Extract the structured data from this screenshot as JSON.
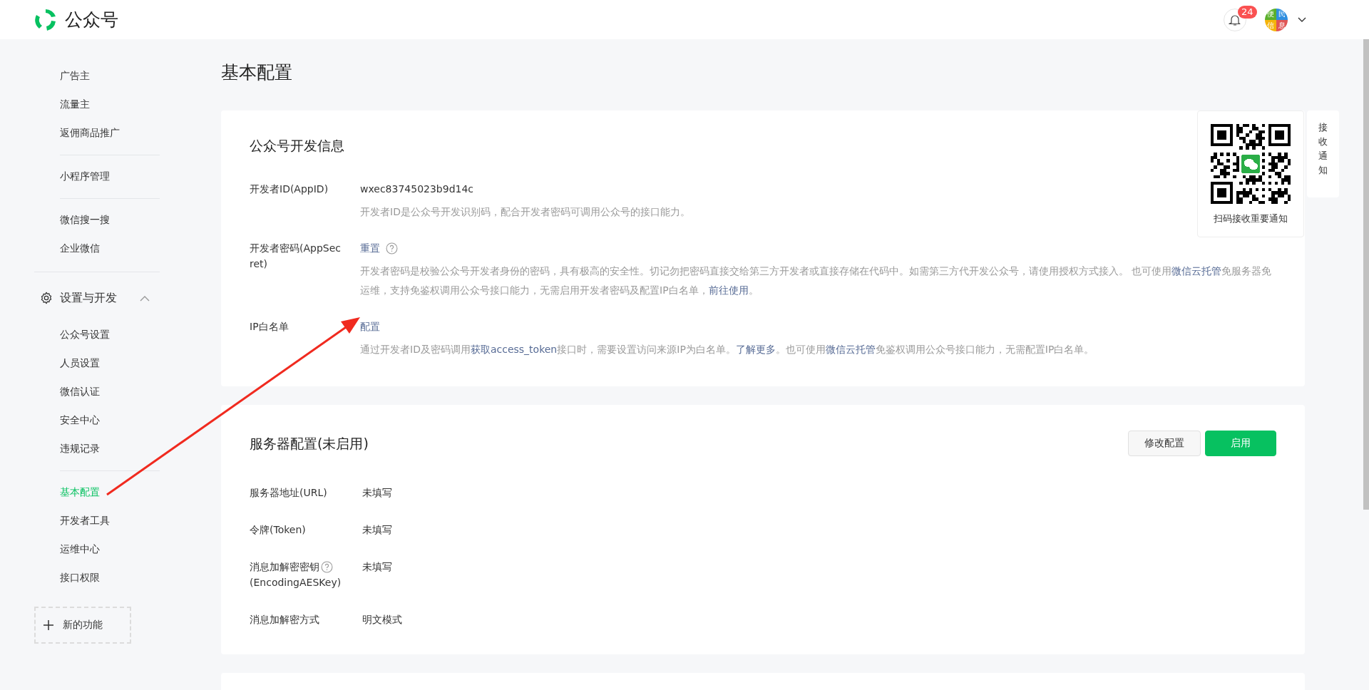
{
  "header": {
    "product_name": "公众号",
    "notification_count": "24",
    "avatar_text": [
      "便",
      "民",
      "信",
      "息"
    ]
  },
  "sidebar": {
    "sections": [
      {
        "kind": "group",
        "items": [
          {
            "label": "广告主",
            "selected": false
          },
          {
            "label": "流量主",
            "selected": false
          },
          {
            "label": "返佣商品推广",
            "selected": false
          }
        ]
      },
      {
        "kind": "group",
        "items": [
          {
            "label": "小程序管理",
            "selected": false
          }
        ]
      },
      {
        "kind": "group",
        "items": [
          {
            "label": "微信搜一搜",
            "selected": false
          },
          {
            "label": "企业微信",
            "selected": false
          }
        ]
      },
      {
        "kind": "category",
        "heading": "设置与开发",
        "expanded": true,
        "groups": [
          {
            "items": [
              {
                "label": "公众号设置",
                "selected": false
              },
              {
                "label": "人员设置",
                "selected": false
              },
              {
                "label": "微信认证",
                "selected": false
              },
              {
                "label": "安全中心",
                "selected": false
              },
              {
                "label": "违规记录",
                "selected": false
              }
            ]
          },
          {
            "items": [
              {
                "label": "基本配置",
                "selected": true
              },
              {
                "label": "开发者工具",
                "selected": false
              },
              {
                "label": "运维中心",
                "selected": false
              },
              {
                "label": "接口权限",
                "selected": false
              }
            ]
          }
        ]
      }
    ],
    "new_feature": "新的功能"
  },
  "page_title": "基本配置",
  "dev_info": {
    "title": "公众号开发信息",
    "rows": [
      {
        "label": "开发者ID(AppID)",
        "value": {
          "kind": "text",
          "text": "wxec83745023b9d14c",
          "help": false
        },
        "description": [
          {
            "kind": "text",
            "text": "开发者ID是公众号开发识别码，配合开发者密码可调用公众号的接口能力。"
          }
        ]
      },
      {
        "label": "开发者密码(AppSecret)",
        "value": {
          "kind": "link",
          "text": "重置",
          "help": true
        },
        "description": [
          {
            "kind": "text",
            "text": "开发者密码是校验公众号开发者身份的密码，具有极高的安全性。切记勿把密码直接交给第三方开发者或直接存储在代码中。如需第三方代开发公众号，请使用授权方式接入。 也可使用"
          },
          {
            "kind": "link",
            "text": "微信云托管"
          },
          {
            "kind": "text",
            "text": "免服务器免运维，支持免鉴权调用公众号接口能力，无需启用开发者密码及配置IP白名单，"
          },
          {
            "kind": "link",
            "text": "前往使用"
          },
          {
            "kind": "text",
            "text": "。"
          }
        ]
      },
      {
        "label": "IP白名单",
        "value": {
          "kind": "link",
          "text": "配置",
          "help": false
        },
        "description": [
          {
            "kind": "text",
            "text": "通过开发者ID及密码调用"
          },
          {
            "kind": "link",
            "text": "获取access_token"
          },
          {
            "kind": "text",
            "text": "接口时，需要设置访问来源IP为白名单。"
          },
          {
            "kind": "link",
            "text": "了解更多"
          },
          {
            "kind": "text",
            "text": "。也可使用"
          },
          {
            "kind": "link",
            "text": "微信云托管"
          },
          {
            "kind": "text",
            "text": "免鉴权调用公众号接口能力，无需配置IP白名单。"
          }
        ]
      }
    ]
  },
  "server_config": {
    "title": "服务器配置(未启用)",
    "buttons": [
      {
        "label": "修改配置",
        "kind": "default"
      },
      {
        "label": "启用",
        "kind": "primary"
      }
    ],
    "rows": [
      {
        "label": "服务器地址(URL)",
        "value": "未填写",
        "help": false
      },
      {
        "label": "令牌(Token)",
        "value": "未填写",
        "help": false
      },
      {
        "label": "消息加解密密钥",
        "label_note": "(EncodingAESKey)",
        "value": "未填写",
        "help": true
      },
      {
        "label": "消息加解密方式",
        "value": "明文模式",
        "help": false
      }
    ]
  },
  "qr_popover": {
    "caption": "扫码接收重要通知"
  },
  "side_tab": {
    "label": "接收通知"
  }
}
